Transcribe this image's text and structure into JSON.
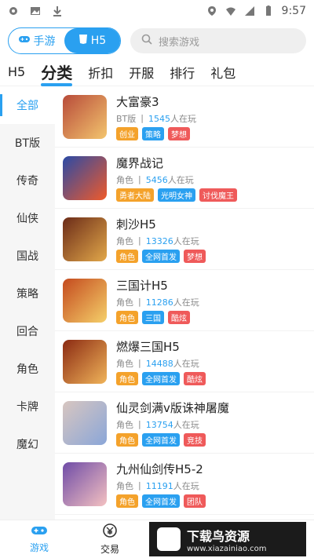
{
  "statusbar": {
    "time": "9:57"
  },
  "toggle": {
    "left_label": "手游",
    "right_label": "H5"
  },
  "search": {
    "placeholder": "搜索游戏"
  },
  "tabs": [
    {
      "label": "H5",
      "active": false
    },
    {
      "label": "分类",
      "active": true
    },
    {
      "label": "折扣",
      "active": false
    },
    {
      "label": "开服",
      "active": false
    },
    {
      "label": "排行",
      "active": false
    },
    {
      "label": "礼包",
      "active": false
    }
  ],
  "sidebar": [
    {
      "label": "全部",
      "active": true
    },
    {
      "label": "BT版"
    },
    {
      "label": "传奇"
    },
    {
      "label": "仙侠"
    },
    {
      "label": "国战"
    },
    {
      "label": "策略"
    },
    {
      "label": "回合"
    },
    {
      "label": "角色"
    },
    {
      "label": "卡牌"
    },
    {
      "label": "魔幻"
    }
  ],
  "games": [
    {
      "title": "大富豪3",
      "category": "BT版",
      "players": "1545",
      "suffix": "人在玩",
      "tags": [
        [
          "创业",
          "o"
        ],
        [
          "策略",
          "b"
        ],
        [
          "梦想",
          "r"
        ]
      ],
      "thumb": "#b84b3a"
    },
    {
      "title": "魔界战记",
      "category": "角色",
      "players": "5456",
      "suffix": "人在玩",
      "tags": [
        [
          "勇者大陆",
          "o"
        ],
        [
          "光明女神",
          "b"
        ],
        [
          "讨伐魔王",
          "r"
        ]
      ],
      "thumb": "#2a4aa6"
    },
    {
      "title": "刺沙H5",
      "category": "角色",
      "players": "13326",
      "suffix": "人在玩",
      "tags": [
        [
          "角色",
          "o"
        ],
        [
          "全网首发",
          "b"
        ],
        [
          "梦想",
          "r"
        ]
      ],
      "thumb": "#6b2b18"
    },
    {
      "title": "三国计H5",
      "category": "角色",
      "players": "11286",
      "suffix": "人在玩",
      "tags": [
        [
          "角色",
          "o"
        ],
        [
          "三国",
          "b"
        ],
        [
          "酷炫",
          "r"
        ]
      ],
      "thumb": "#c44a1e"
    },
    {
      "title": "燃爆三国H5",
      "category": "角色",
      "players": "14488",
      "suffix": "人在玩",
      "tags": [
        [
          "角色",
          "o"
        ],
        [
          "全网首发",
          "b"
        ],
        [
          "酷炫",
          "r"
        ]
      ],
      "thumb": "#8b2a12"
    },
    {
      "title": "仙灵剑满v版诛神屠魔",
      "category": "角色",
      "players": "13754",
      "suffix": "人在玩",
      "tags": [
        [
          "角色",
          "o"
        ],
        [
          "全网首发",
          "b"
        ],
        [
          "竞技",
          "r"
        ]
      ],
      "thumb": "#d8c6c0"
    },
    {
      "title": "九州仙剑传H5-2",
      "category": "角色",
      "players": "11191",
      "suffix": "人在玩",
      "tags": [
        [
          "角色",
          "o"
        ],
        [
          "全网首发",
          "b"
        ],
        [
          "团队",
          "r"
        ]
      ],
      "thumb": "#6f4ca7"
    }
  ],
  "bottom": {
    "nav": [
      {
        "label": "游戏",
        "active": true
      },
      {
        "label": "交易",
        "active": false
      }
    ],
    "brand_title": "下载鸟资源",
    "brand_url": "www.xiazainiao.com"
  },
  "colors": {
    "accent": "#2aa0f0",
    "orange": "#f4a22b",
    "red": "#ef5a5a"
  }
}
